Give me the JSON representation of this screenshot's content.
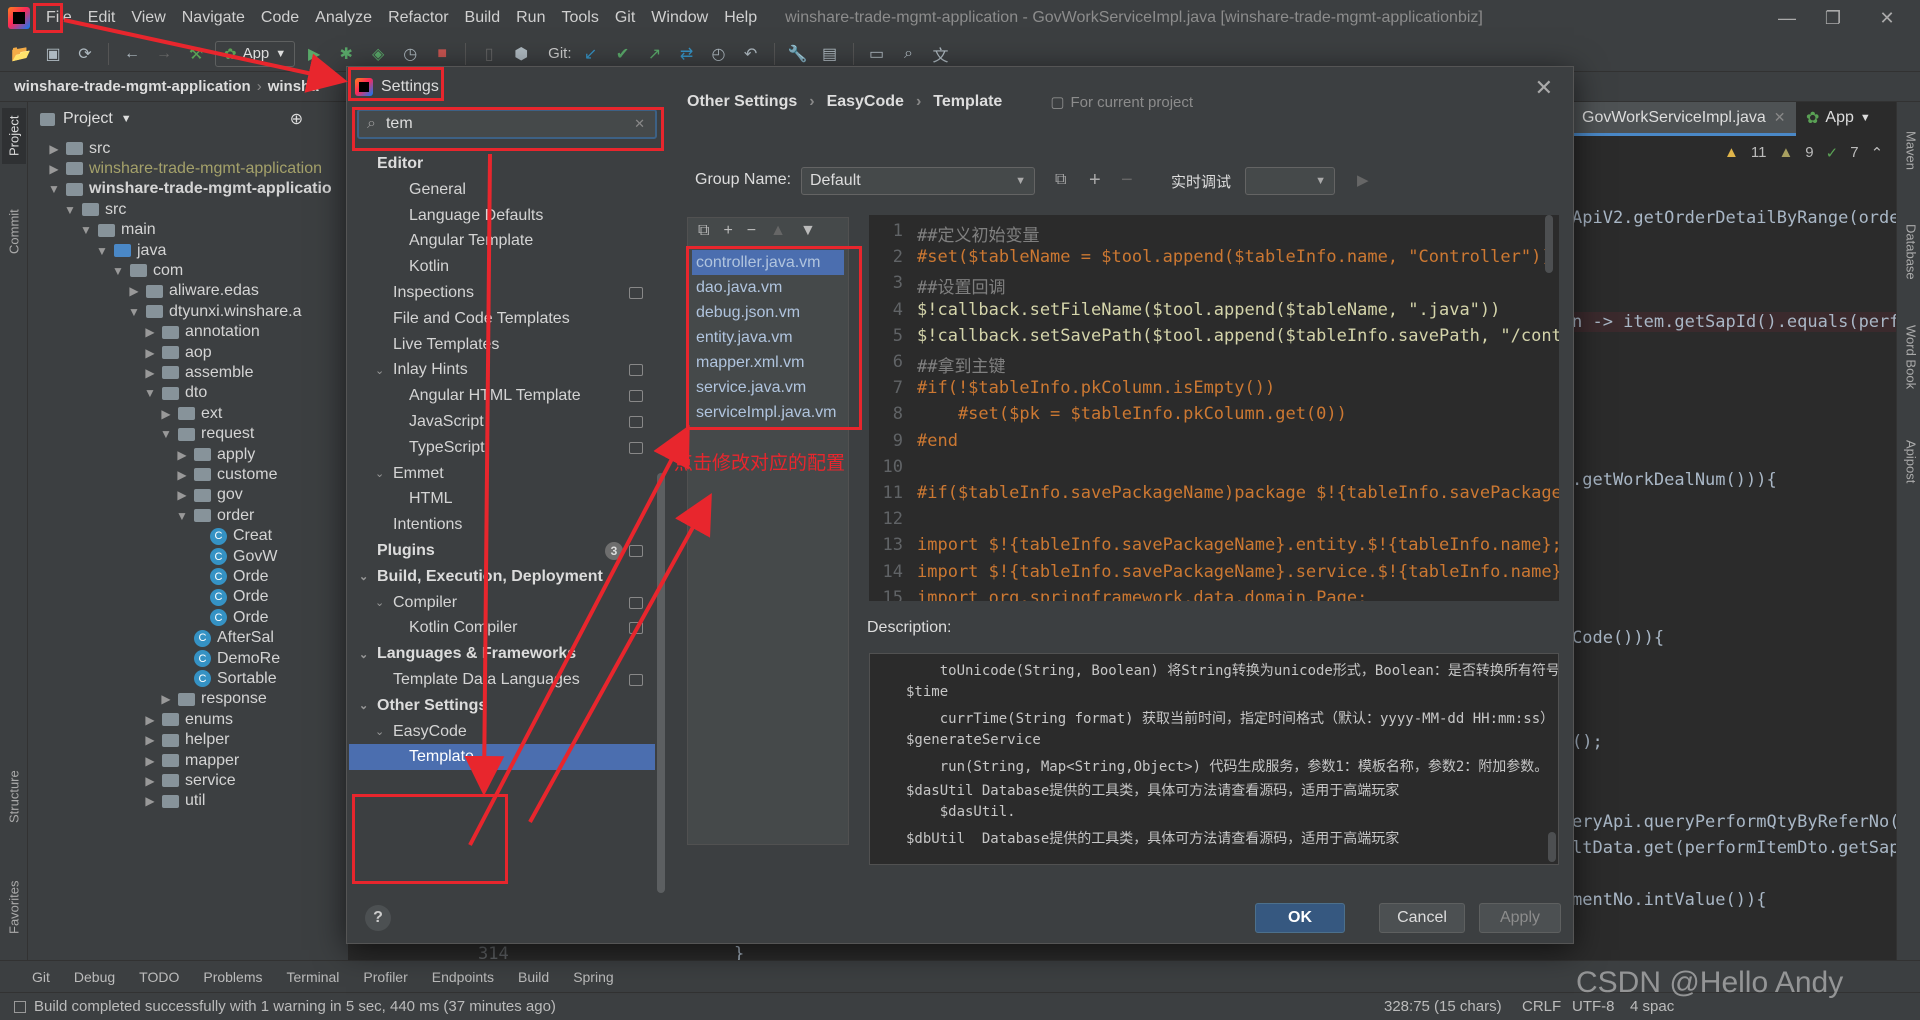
{
  "app": {
    "menu": [
      "File",
      "Edit",
      "View",
      "Navigate",
      "Code",
      "Analyze",
      "Refactor",
      "Build",
      "Run",
      "Tools",
      "Git",
      "Window",
      "Help"
    ],
    "window_title": "winshare-trade-mgmt-application - GovWorkServiceImpl.java [winshare-trade-mgmt-applicationbiz]"
  },
  "toolbar": {
    "run_config": "App",
    "git_label": "Git:"
  },
  "navbar": {
    "project": "winshare-trade-mgmt-application",
    "partial": "winsha"
  },
  "project_panel": {
    "title": "Project",
    "tree": [
      {
        "label": "src",
        "depth": 1,
        "arrow": "▶",
        "icon": "folder"
      },
      {
        "label": "winshare-trade-mgmt-application",
        "depth": 1,
        "arrow": "▶",
        "icon": "folder",
        "muted": true
      },
      {
        "label": "winshare-trade-mgmt-applicatio",
        "depth": 1,
        "arrow": "▼",
        "icon": "folder",
        "bold": true
      },
      {
        "label": "src",
        "depth": 2,
        "arrow": "▼",
        "icon": "folder"
      },
      {
        "label": "main",
        "depth": 3,
        "arrow": "▼",
        "icon": "folder"
      },
      {
        "label": "java",
        "depth": 4,
        "arrow": "▼",
        "icon": "folder-blue"
      },
      {
        "label": "com",
        "depth": 5,
        "arrow": "▼",
        "icon": "folder"
      },
      {
        "label": "aliware.edas",
        "depth": 6,
        "arrow": "▶",
        "icon": "folder"
      },
      {
        "label": "dtyunxi.winshare.a",
        "depth": 6,
        "arrow": "▼",
        "icon": "folder"
      },
      {
        "label": "annotation",
        "depth": 7,
        "arrow": "▶",
        "icon": "folder"
      },
      {
        "label": "aop",
        "depth": 7,
        "arrow": "▶",
        "icon": "folder"
      },
      {
        "label": "assemble",
        "depth": 7,
        "arrow": "▶",
        "icon": "folder"
      },
      {
        "label": "dto",
        "depth": 7,
        "arrow": "▼",
        "icon": "folder"
      },
      {
        "label": "ext",
        "depth": 8,
        "arrow": "▶",
        "icon": "folder"
      },
      {
        "label": "request",
        "depth": 8,
        "arrow": "▼",
        "icon": "folder"
      },
      {
        "label": "apply",
        "depth": 9,
        "arrow": "▶",
        "icon": "folder"
      },
      {
        "label": "custome",
        "depth": 9,
        "arrow": "▶",
        "icon": "folder"
      },
      {
        "label": "gov",
        "depth": 9,
        "arrow": "▶",
        "icon": "folder"
      },
      {
        "label": "order",
        "depth": 9,
        "arrow": "▼",
        "icon": "folder"
      },
      {
        "label": "Creat",
        "depth": 10,
        "arrow": "",
        "icon": "class"
      },
      {
        "label": "GovW",
        "depth": 10,
        "arrow": "",
        "icon": "class"
      },
      {
        "label": "Orde",
        "depth": 10,
        "arrow": "",
        "icon": "class"
      },
      {
        "label": "Orde",
        "depth": 10,
        "arrow": "",
        "icon": "class"
      },
      {
        "label": "Orde",
        "depth": 10,
        "arrow": "",
        "icon": "class"
      },
      {
        "label": "AfterSal",
        "depth": 9,
        "arrow": "",
        "icon": "class"
      },
      {
        "label": "DemoRe",
        "depth": 9,
        "arrow": "",
        "icon": "class"
      },
      {
        "label": "Sortable",
        "depth": 9,
        "arrow": "",
        "icon": "class"
      },
      {
        "label": "response",
        "depth": 8,
        "arrow": "▶",
        "icon": "folder"
      },
      {
        "label": "enums",
        "depth": 7,
        "arrow": "▶",
        "icon": "folder"
      },
      {
        "label": "helper",
        "depth": 7,
        "arrow": "▶",
        "icon": "folder"
      },
      {
        "label": "mapper",
        "depth": 7,
        "arrow": "▶",
        "icon": "folder"
      },
      {
        "label": "service",
        "depth": 7,
        "arrow": "▶",
        "icon": "folder"
      },
      {
        "label": "util",
        "depth": 7,
        "arrow": "▶",
        "icon": "folder"
      }
    ]
  },
  "left_strip": [
    "Project",
    "Commit",
    "Structure",
    "Favorites"
  ],
  "right_strip": [
    "Maven",
    "Database",
    "Word Book",
    "Apipost"
  ],
  "editor": {
    "tab": "GovWorkServiceImpl.java",
    "app_label": "App",
    "inspections": {
      "warnings": "11",
      "weak": "9",
      "ok": "7"
    },
    "gutter_line": "314",
    "code_fragments": [
      "ApiV2.getOrderDetailByRange(orde",
      "n -> item.getSapId().equals(perfo",
      ".getWorkDealNum())){",
      "Code())){",
      "();",
      "eryApi.queryPerformQtyByReferNo(p",
      "ltData.get(performItemDto.getSap",
      "mentNo.intValue()){",
      "}"
    ]
  },
  "settings": {
    "title": "Settings",
    "search_value": "tem",
    "tree": [
      {
        "label": "Editor",
        "indent": 0,
        "bold": true
      },
      {
        "label": "General",
        "indent": 2
      },
      {
        "label": "Language Defaults",
        "indent": 2
      },
      {
        "label": "Angular Template",
        "indent": 2
      },
      {
        "label": "Kotlin",
        "indent": 2
      },
      {
        "label": "Inspections",
        "indent": 1,
        "icon": true
      },
      {
        "label": "File and Code Templates",
        "indent": 1
      },
      {
        "label": "Live Templates",
        "indent": 1
      },
      {
        "label": "Inlay Hints",
        "indent": 1,
        "arrow": "▼",
        "icon": true
      },
      {
        "label": "Angular HTML Template",
        "indent": 2,
        "icon": true
      },
      {
        "label": "JavaScript",
        "indent": 2,
        "icon": true
      },
      {
        "label": "TypeScript",
        "indent": 2,
        "icon": true
      },
      {
        "label": "Emmet",
        "indent": 1,
        "arrow": "▼"
      },
      {
        "label": "HTML",
        "indent": 2
      },
      {
        "label": "Intentions",
        "indent": 1
      },
      {
        "label": "Plugins",
        "indent": 0,
        "bold": true,
        "badge": "3"
      },
      {
        "label": "Build, Execution, Deployment",
        "indent": 0,
        "bold": true,
        "arrow": "▼"
      },
      {
        "label": "Compiler",
        "indent": 1,
        "arrow": "▼",
        "icon": true
      },
      {
        "label": "Kotlin Compiler",
        "indent": 2,
        "icon": true
      },
      {
        "label": "Languages & Frameworks",
        "indent": 0,
        "bold": true,
        "arrow": "▼"
      },
      {
        "label": "Template Data Languages",
        "indent": 1,
        "icon": true
      },
      {
        "label": "Other Settings",
        "indent": 0,
        "bold": true,
        "arrow": "▼"
      },
      {
        "label": "EasyCode",
        "indent": 1,
        "arrow": "▼"
      },
      {
        "label": "Template",
        "indent": 2,
        "selected": true
      }
    ],
    "breadcrumb": [
      "Other Settings",
      "EasyCode",
      "Template"
    ],
    "scope_label": "For current project",
    "group_name_label": "Group Name:",
    "group_name_value": "Default",
    "debug_label": "实时调试",
    "files": [
      "controller.java.vm",
      "dao.java.vm",
      "debug.json.vm",
      "entity.java.vm",
      "mapper.xml.vm",
      "service.java.vm",
      "serviceImpl.java.vm"
    ],
    "selected_file": "controller.java.vm",
    "code": [
      {
        "n": "1",
        "t": "##定义初始变量",
        "c": "#808080"
      },
      {
        "n": "2",
        "t": "#set($tableName = $tool.append($tableInfo.name, \"Controller\"))",
        "c": "#cc7832"
      },
      {
        "n": "3",
        "t": "##设置回调",
        "c": "#808080"
      },
      {
        "n": "4",
        "t": "$!callback.setFileName($tool.append($tableName, \".java\"))",
        "c": "#d4d4aa"
      },
      {
        "n": "5",
        "t": "$!callback.setSavePath($tool.append($tableInfo.savePath, \"/contr",
        "c": "#d4d4aa"
      },
      {
        "n": "6",
        "t": "##拿到主键",
        "c": "#808080"
      },
      {
        "n": "7",
        "t": "#if(!$tableInfo.pkColumn.isEmpty())",
        "c": "#cc7832"
      },
      {
        "n": "8",
        "t": "    #set($pk = $tableInfo.pkColumn.get(0))",
        "c": "#cc7832"
      },
      {
        "n": "9",
        "t": "#end",
        "c": "#cc7832"
      },
      {
        "n": "10",
        "t": "",
        "c": "#a9b7c6"
      },
      {
        "n": "11",
        "t": "#if($tableInfo.savePackageName)package $!{tableInfo.savePackageN",
        "c": "#cc7832"
      },
      {
        "n": "12",
        "t": "",
        "c": "#a9b7c6"
      },
      {
        "n": "13",
        "t": "import $!{tableInfo.savePackageName}.entity.$!{tableInfo.name};",
        "c": "#cc7832"
      },
      {
        "n": "14",
        "t": "import $!{tableInfo.savePackageName}.service.$!{tableInfo.name}S",
        "c": "#cc7832"
      },
      {
        "n": "15",
        "t": "import org.springframework.data.domain.Page;",
        "c": "#cc7832"
      }
    ],
    "description_label": "Description:",
    "description": [
      "    toUnicode(String, Boolean) 将String转换为unicode形式，Boolean：是否转换所有符号",
      "$time",
      "    currTime(String format) 获取当前时间，指定时间格式（默认：yyyy-MM-dd HH:mm:ss）",
      "$generateService",
      "    run(String, Map<String,Object>) 代码生成服务，参数1：模板名称，参数2：附加参数。",
      "$dasUtil Database提供的工具类，具体可方法请查看源码，适用于高端玩家",
      "    $dasUtil.",
      "$dbUtil  Database提供的工具类，具体可方法请查看源码，适用于高端玩家"
    ],
    "buttons": {
      "ok": "OK",
      "cancel": "Cancel",
      "apply": "Apply"
    }
  },
  "annotation": {
    "text": "点击修改对应的配置",
    "color": "#e8262d"
  },
  "tool_windows": [
    "Git",
    "Debug",
    "TODO",
    "Problems",
    "Terminal",
    "Profiler",
    "Endpoints",
    "Build",
    "Spring"
  ],
  "status": {
    "message": "Build completed successfully with 1 warning in 5 sec, 440 ms (37 minutes ago)",
    "position": "328:75 (15 chars)",
    "line_sep": "CRLF",
    "encoding": "UTF-8",
    "indent": "4 spac",
    "watermark": "CSDN @Hello Andy"
  }
}
